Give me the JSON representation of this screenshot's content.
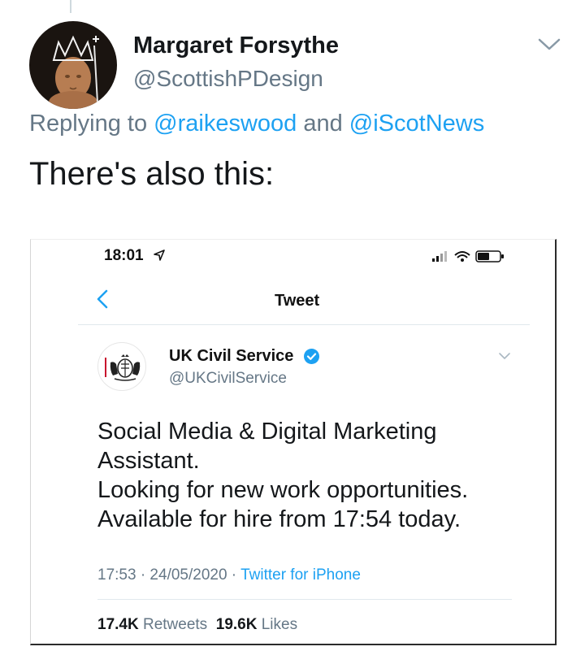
{
  "tweet": {
    "author_name": "Margaret Forsythe",
    "author_handle": "@ScottishPDesign",
    "replying_prefix": "Replying to",
    "replying_mention_1": "@raikeswood",
    "replying_conjunction": "and",
    "replying_mention_2": "@iScotNews",
    "text": "There's also this:"
  },
  "embedded_screenshot": {
    "status_time": "18:01",
    "header_title": "Tweet",
    "author_name": "UK Civil Service",
    "author_handle": "@UKCivilService",
    "body_lines": [
      "Social Media & Digital Marketing",
      "Assistant.",
      "Looking for new work opportunities.",
      "Available for hire from 17:54 today."
    ],
    "timestamp": "17:53 · 24/05/2020 ·",
    "source": "Twitter for iPhone",
    "retweets_count": "17.4K",
    "retweets_label": "Retweets",
    "likes_count": "19.6K",
    "likes_label": "Likes"
  },
  "icons": {
    "avatar": "avatar-crown-figure",
    "more_menu": "chevron-down-icon",
    "back": "chevron-left-icon",
    "verified": "verified-badge-icon",
    "location": "location-arrow-icon",
    "signal": "signal-icon",
    "wifi": "wifi-icon",
    "battery": "battery-icon",
    "crest": "royal-crest-icon"
  },
  "colors": {
    "link_blue": "#1da1f2",
    "secondary_text": "#657786",
    "primary_text": "#14171a"
  }
}
